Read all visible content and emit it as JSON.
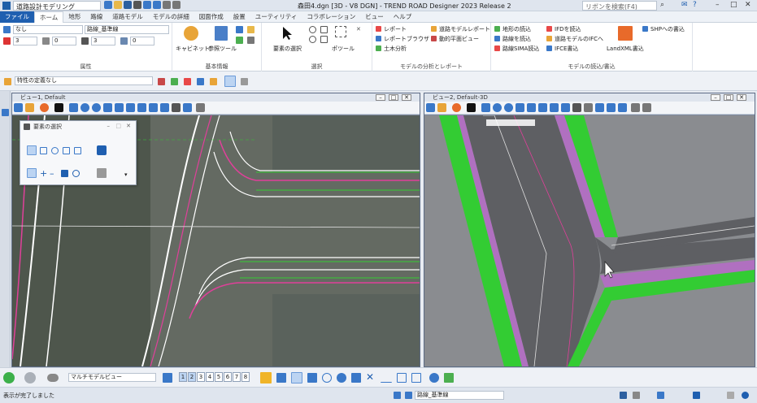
{
  "titlebar": {
    "workspace": "道路設計モデリング",
    "title": "森田4.dgn [3D - V8 DGN] - TREND ROAD Designer 2023 Release 2",
    "search_placeholder": "リボンを検索(F4)"
  },
  "tabs": [
    "ファイル",
    "ホーム",
    "地形",
    "路線",
    "道路モデル",
    "モデルの詳細",
    "図面作成",
    "設置",
    "ユーティリティ",
    "コラボレーション",
    "ビュー",
    "ヘルプ"
  ],
  "ribbon": {
    "attributes": {
      "level_combo": "なし",
      "style_combo": "路線_基準線",
      "color_value": "3",
      "weight_value": "0",
      "style_value": "3",
      "transparency_value": "0",
      "label": "属性"
    },
    "basic": {
      "caption1": "キャビネット",
      "caption2": "参照ツール",
      "label": "基本情報"
    },
    "selection": {
      "caption1": "要素の選択",
      "caption2": "ポツール",
      "label": "選択"
    },
    "analysis": {
      "items": [
        "レポート",
        "レポートブラウザ",
        "土木分析",
        "道路モデルレポート",
        "動的平面ビュー"
      ],
      "label": "モデルの分析とレポート"
    },
    "io": {
      "items": [
        "地形の読込",
        "路線を読込",
        "路線SIMA読込",
        "IFDを読込",
        "道路モデルのIFCへ",
        "IFCE書込",
        "LandXML書込",
        "SHPへの書込"
      ],
      "label": "モデルの読込/書込"
    }
  },
  "attrbar": {
    "template_combo": "特性の定義なし"
  },
  "view1": {
    "title": "ビュー1, Default"
  },
  "view2": {
    "title": "ビュー2, Default-3D"
  },
  "dialog": {
    "title": "要素の選択"
  },
  "bottombar": {
    "view_combo": "マルチモデルビュー",
    "view_numbers": [
      "1",
      "2",
      "3",
      "4",
      "5",
      "6",
      "7",
      "8"
    ]
  },
  "statusbar": {
    "message": "表示が完了しました",
    "level_field": "路線_基準線"
  },
  "colors": {
    "accent": "#1f5fb0",
    "road_green": "#33cc33",
    "highlight_magenta": "#e0409a"
  }
}
